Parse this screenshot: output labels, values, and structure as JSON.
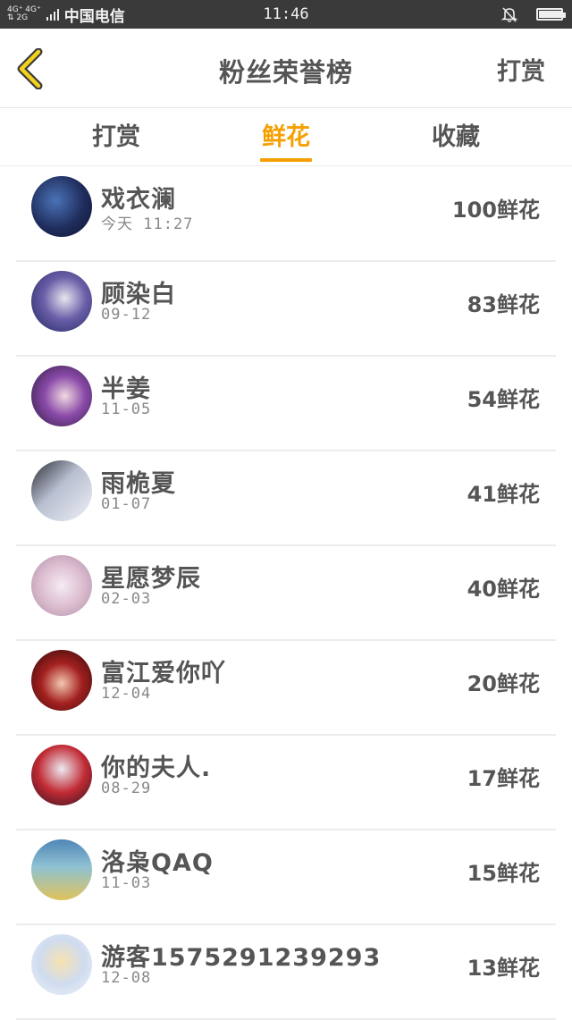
{
  "status": {
    "network_top": "4G⁺ 4G⁺",
    "network_bottom": "⇅ 2G",
    "carrier": "中国电信",
    "time": "11:46",
    "battery_level": 0.95
  },
  "header": {
    "back_icon": "chevron-left-icon",
    "title": "粉丝荣誉榜",
    "action": "打赏",
    "accent": "#f5a000"
  },
  "tabs": [
    {
      "label": "打赏",
      "active": false
    },
    {
      "label": "鲜花",
      "active": true
    },
    {
      "label": "收藏",
      "active": false
    }
  ],
  "fans": [
    {
      "name": "戏衣澜",
      "date": "今天 11:27",
      "amount": "100鲜花",
      "avatar": "blue"
    },
    {
      "name": "顾染白",
      "date": "09-12",
      "amount": "83鲜花",
      "avatar": "navy"
    },
    {
      "name": "半姜",
      "date": "11-05",
      "amount": "54鲜花",
      "avatar": "purple"
    },
    {
      "name": "雨桅夏",
      "date": "01-07",
      "amount": "41鲜花",
      "avatar": "grey"
    },
    {
      "name": "星愿梦辰",
      "date": "02-03",
      "amount": "40鲜花",
      "avatar": "pink"
    },
    {
      "name": "富江爱你吖",
      "date": "12-04",
      "amount": "20鲜花",
      "avatar": "red"
    },
    {
      "name": "你的夫人.",
      "date": "08-29",
      "amount": "17鲜花",
      "avatar": "crimson"
    },
    {
      "name": "洛枭QAQ",
      "date": "11-03",
      "amount": "15鲜花",
      "avatar": "teal"
    },
    {
      "name": "游客1575291239293",
      "date": "12-08",
      "amount": "13鲜花",
      "avatar": "light"
    }
  ]
}
